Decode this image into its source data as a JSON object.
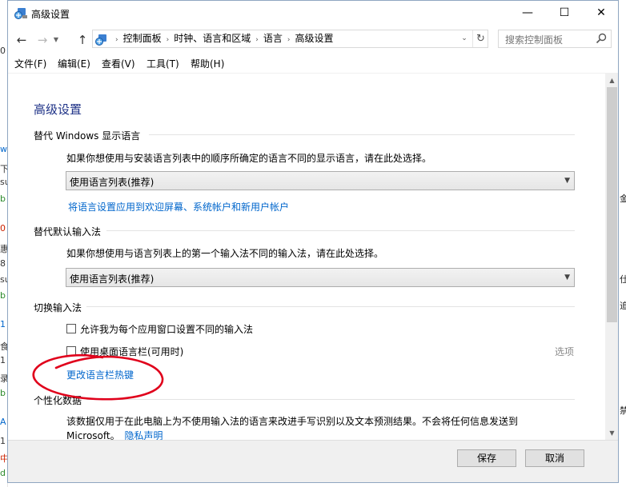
{
  "window": {
    "title": "高级设置",
    "controls": {
      "minimize": "—",
      "maximize": "☐",
      "close": "✕"
    }
  },
  "addressbar": {
    "breadcrumbs": [
      "控制面板",
      "时钟、语言和区域",
      "语言",
      "高级设置"
    ],
    "search_placeholder": "搜索控制面板"
  },
  "menu": [
    "文件(F)",
    "编辑(E)",
    "查看(V)",
    "工具(T)",
    "帮助(H)"
  ],
  "content": {
    "heading": "高级设置",
    "display_language": {
      "title": "替代 Windows 显示语言",
      "description": "如果你想使用与安装语言列表中的顺序所确定的语言不同的显示语言，请在此处选择。",
      "selected": "使用语言列表(推荐)",
      "link": "将语言设置应用到欢迎屏幕、系统帐户和新用户帐户"
    },
    "default_input": {
      "title": "替代默认输入法",
      "description": "如果你想使用与语言列表上的第一个输入法不同的输入法，请在此处选择。",
      "selected": "使用语言列表(推荐)"
    },
    "switch_input": {
      "title": "切换输入法",
      "checkbox_per_app": "允许我为每个应用窗口设置不同的输入法",
      "checkbox_language_bar": "使用桌面语言栏(可用时)",
      "options_link": "选项",
      "hotkeys_link": "更改语言栏热键"
    },
    "personalization": {
      "title": "个性化数据",
      "description_line1": "该数据仅用于在此电脑上为不使用输入法的语言来改进手写识别以及文本预测结果。不会将任何信息发送到",
      "description_line2": "Microsoft。",
      "privacy_link": "隐私声明"
    }
  },
  "footer": {
    "save": "保存",
    "cancel": "取消"
  },
  "background": {
    "left_fragments": [
      "0",
      "w",
      "下",
      "su",
      "b",
      "0",
      "惠",
      "8",
      "su",
      "b",
      "1",
      "食",
      "1",
      "录",
      "b",
      "A",
      "1",
      "中",
      "d"
    ],
    "right_fragments": [
      "金",
      "仕",
      "追",
      "禁"
    ]
  },
  "colors": {
    "heading": "#1e3287",
    "link": "#0066cc",
    "annotation": "#e0001b"
  }
}
